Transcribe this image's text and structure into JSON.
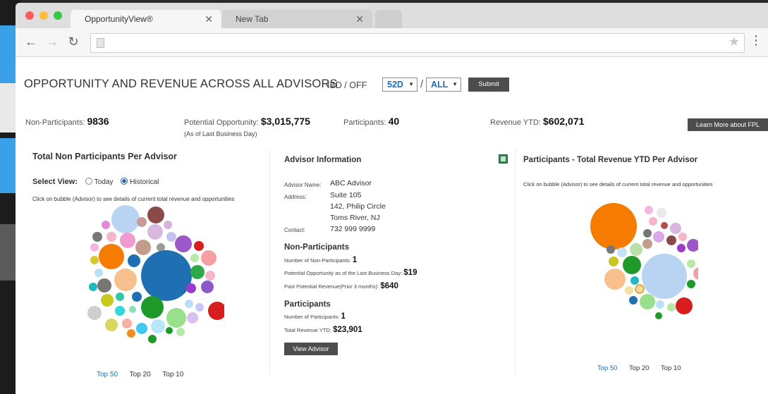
{
  "browser": {
    "tabs": [
      {
        "label": "OpportunityView®"
      },
      {
        "label": "New Tab"
      }
    ],
    "tab_close_symbol": "✕"
  },
  "header": {
    "title": "OPPORTUNITY AND REVENUE ACROSS ALL ADVISORS",
    "ibd_label": "IBD / OFF",
    "period_select": "52D",
    "scope_select": "ALL",
    "slash": "/",
    "submit_label": "Submit"
  },
  "stats": {
    "non_participants_label": "Non-Participants:",
    "non_participants_value": "9836",
    "potential_label": "Potential Opportunity:",
    "potential_value": "$3,015,775",
    "potential_note": "(As of Last Business Day)",
    "participants_label": "Participants:",
    "participants_value": "40",
    "revenue_label": "Revenue YTD:",
    "revenue_value": "$602,071",
    "learn_more_label": "Learn More about FPL"
  },
  "left_panel": {
    "title": "Total Non Participants Per Advisor",
    "select_view_label": "Select View:",
    "option_today": "Today",
    "option_historical": "Historical",
    "help_text": "Click on bubble (Advisor) to see details of current total revenue and opportunities",
    "nav": [
      "Top 50",
      "Top 20",
      "Top 10"
    ]
  },
  "advisor_info": {
    "title": "Advisor Information",
    "name_label": "Advisor Name:",
    "name_value": "ABC Advisor",
    "address_label": "Address:",
    "address_line1": "Suite 105",
    "address_line2": "142, Philip Circle",
    "address_line3": "Toms River, NJ",
    "contact_label": "Contact:",
    "contact_value": "732 999 9999",
    "non_participants_title": "Non-Participants",
    "np_number_label": "Number of Non-Participants:",
    "np_number_value": "1",
    "np_potential_label": "Potential Opportunity as of the Last Business Day:",
    "np_potential_value": "$19",
    "np_past_label": "Past Potential Revenue(Prior 3 months):",
    "np_past_value": "$640",
    "participants_title": "Participants",
    "p_number_label": "Number of Participants:",
    "p_number_value": "1",
    "p_revenue_label": "Total Revenue YTD:",
    "p_revenue_value": "$23,901",
    "view_button_label": "View Advisor"
  },
  "right_panel": {
    "title": "Participants - Total Revenue YTD Per Advisor",
    "help_text": "Click on bubble (Advisor) to see details of current total revenue and opportunities",
    "nav": [
      "Top 50",
      "Top 20",
      "Top 10"
    ]
  },
  "colors": {
    "accent_blue": "#1f6fb3",
    "button_dark": "#4d4d4d"
  }
}
